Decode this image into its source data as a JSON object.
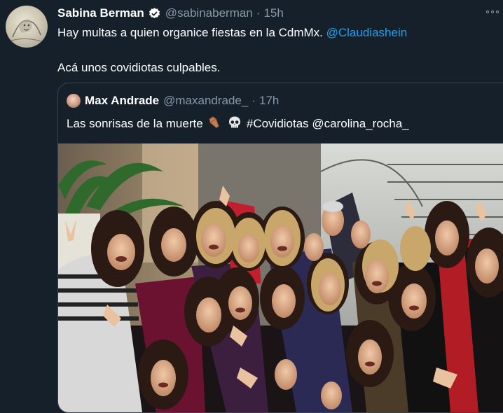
{
  "tweet": {
    "author_name": "Sabina Berman",
    "author_handle": "@sabinaberman",
    "separator": "·",
    "time": "15h",
    "text_prefix": "Hay multas a quien organice fiestas en la CdmMx. ",
    "mention": "@Claudiashein",
    "text_line2": "Acá unos covidiotas culpables."
  },
  "quoted": {
    "author_name": "Max Andrade",
    "author_handle": "@maxandrade_",
    "separator": "·",
    "time": "17h",
    "text_part1": "Las sonrisas de la muerte",
    "text_part2": "#Covidiotas @carolina_rocha_",
    "emojis": [
      "coffin-emoji",
      "skull-emoji"
    ]
  },
  "icons": [
    "verified-badge-icon",
    "more-options-icon"
  ],
  "colors": {
    "background": "#15202b",
    "text": "#ffffff",
    "secondary": "#8899a6",
    "link": "#1da1f2",
    "border": "#38444d",
    "verified": "#ffffff"
  }
}
